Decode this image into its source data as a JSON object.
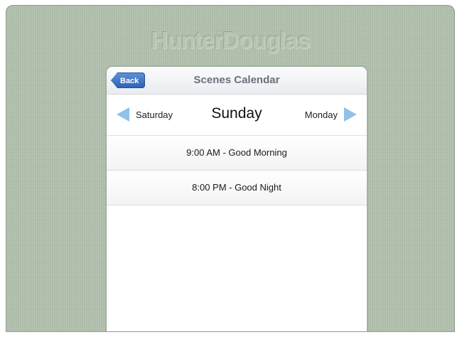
{
  "background": {
    "brand_text": "HunterDouglas",
    "color": "#b4c3b0"
  },
  "navbar": {
    "back_label": "Back",
    "title": "Scenes Calendar"
  },
  "day_nav": {
    "previous": "Saturday",
    "current": "Sunday",
    "next": "Monday",
    "arrow_color": "#8fc1ea"
  },
  "scenes": [
    {
      "label": "9:00 AM - Good Morning"
    },
    {
      "label": "8:00 PM - Good Night"
    }
  ]
}
